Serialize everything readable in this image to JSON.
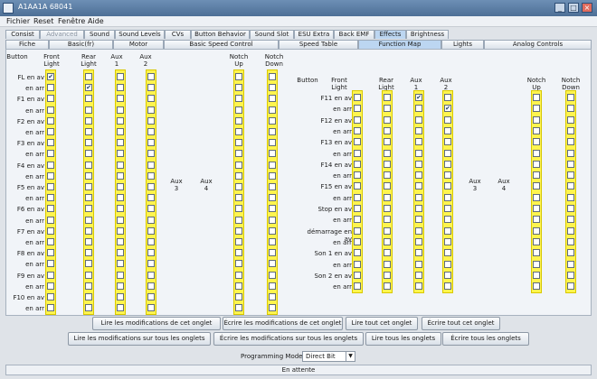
{
  "window": {
    "title": "A1AA1A 68041",
    "minimize": "_",
    "maximize": "□",
    "close": "×"
  },
  "menu": [
    "Fichier",
    "Reset",
    "Fenêtre",
    "Aide"
  ],
  "tabs_row1": [
    "Consist",
    "Advanced",
    "Sound",
    "Sound Levels",
    "CVs",
    "Button Behavior",
    "Sound Slot",
    "ESU Extra",
    "Back EMF",
    "Effects",
    "Brightness"
  ],
  "tabs_row2": [
    "Fiche",
    "Basic(fr)",
    "Motor",
    "Basic Speed Control",
    "Speed Table",
    "Function Map",
    "Lights",
    "Analog Controls"
  ],
  "left_headers": [
    "Button",
    "Front\nLight",
    "Rear\nLight",
    "Aux\n1",
    "Aux\n2",
    "Aux\n3",
    "Aux\n4",
    "Notch\nUp",
    "Notch\nDown"
  ],
  "right_headers": [
    "Button",
    "Front\nLight",
    "Rear\nLight",
    "Aux\n1",
    "Aux\n2",
    "Aux\n3",
    "Aux\n4",
    "Notch\nUp",
    "Notch\nDown"
  ],
  "left_rows": [
    "FL en av",
    "en arr",
    "F1 en av",
    "en arr",
    "F2 en av",
    "en arr",
    "F3 en av",
    "en arr",
    "F4 en av",
    "en arr",
    "F5 en av",
    "en arr",
    "F6 en av",
    "en arr",
    "F7 en av",
    "en arr",
    "F8 en av",
    "en arr",
    "F9 en av",
    "en arr",
    "F10 en av",
    "en arr"
  ],
  "right_rows": [
    "F11 en av",
    "en arr",
    "F12 en av",
    "en arr",
    "F13 en av",
    "en arr",
    "F14 en av",
    "en arr",
    "F15 en av",
    "en arr",
    "Stop en av",
    "en arr",
    "démarrage en av",
    "en arr",
    "Son 1 en av",
    "en arr",
    "Son 2 en av",
    "en arr"
  ],
  "left_checked": [
    [
      0,
      0
    ],
    [
      1,
      1
    ]
  ],
  "right_checked": [
    [
      0,
      2
    ],
    [
      1,
      3
    ]
  ],
  "buttons_row1": [
    "Lire les modifications de cet onglet",
    "Écrire les modifications de cet onglet",
    "Lire tout cet onglet",
    "Écrire tout cet onglet"
  ],
  "buttons_row2": [
    "Lire les modifications sur tous les onglets",
    "Écrire les modifications sur tous les onglets",
    "Lire tous les onglets",
    "Écrire tous les onglets"
  ],
  "programming_mode": {
    "label": "Programming Mode",
    "value": "Direct Bit"
  },
  "status": "En attente",
  "colors": {
    "highlight": "#fff44f",
    "active_tab": "#bcd6f1",
    "titlebar": "#5b7ea8"
  }
}
